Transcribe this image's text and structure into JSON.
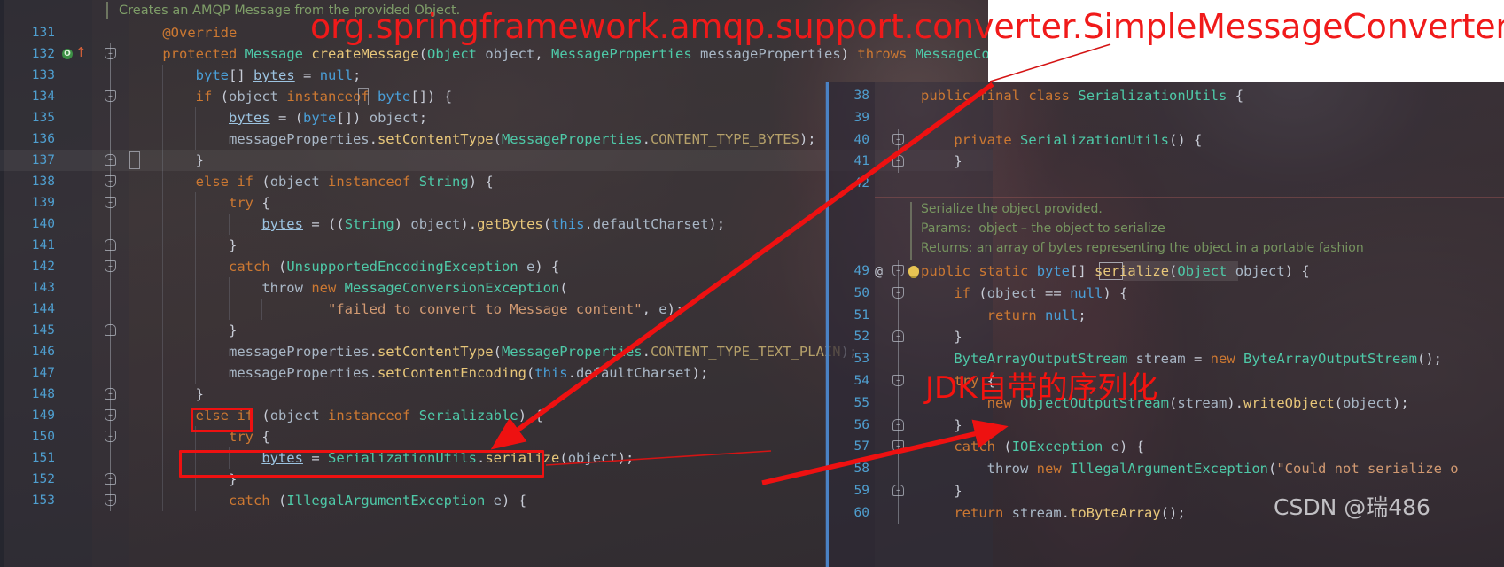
{
  "annotations": {
    "title_class": "org.springframework.amqp.support.converter.SimpleMessageConverter",
    "jdk_note": "JDK自带的序列化",
    "watermark": "CSDN @瑞486"
  },
  "left_editor": {
    "doc_comment": "Creates an AMQP Message from the provided Object.",
    "override_marker_icon": "overridden-method-icon",
    "lines": [
      {
        "num": "131",
        "text": "    @Override"
      },
      {
        "num": "132",
        "text": "    protected Message createMessage(Object object, MessageProperties messageProperties) throws MessageConversionException {"
      },
      {
        "num": "133",
        "text": "        byte[] bytes = null;"
      },
      {
        "num": "134",
        "text": "        if (object instanceof byte[]) {"
      },
      {
        "num": "135",
        "text": "            bytes = (byte[]) object;"
      },
      {
        "num": "136",
        "text": "            messageProperties.setContentType(MessageProperties.CONTENT_TYPE_BYTES);"
      },
      {
        "num": "137",
        "text": "        }"
      },
      {
        "num": "138",
        "text": "        else if (object instanceof String) {"
      },
      {
        "num": "139",
        "text": "            try {"
      },
      {
        "num": "140",
        "text": "                bytes = ((String) object).getBytes(this.defaultCharset);"
      },
      {
        "num": "141",
        "text": "            }"
      },
      {
        "num": "142",
        "text": "            catch (UnsupportedEncodingException e) {"
      },
      {
        "num": "143",
        "text": "                throw new MessageConversionException("
      },
      {
        "num": "144",
        "text": "                        \"failed to convert to Message content\", e);"
      },
      {
        "num": "145",
        "text": "            }"
      },
      {
        "num": "146",
        "text": "            messageProperties.setContentType(MessageProperties.CONTENT_TYPE_TEXT_PLAIN);"
      },
      {
        "num": "147",
        "text": "            messageProperties.setContentEncoding(this.defaultCharset);"
      },
      {
        "num": "148",
        "text": "        }"
      },
      {
        "num": "149",
        "text": "        else if (object instanceof Serializable) {"
      },
      {
        "num": "150",
        "text": "            try {"
      },
      {
        "num": "151",
        "text": "                bytes = SerializationUtils.serialize(object);"
      },
      {
        "num": "152",
        "text": "            }"
      },
      {
        "num": "153",
        "text": "            catch (IllegalArgumentException e) {"
      }
    ]
  },
  "right_popup": {
    "javadoc": [
      "Serialize the object provided.",
      "Params:  object – the object to serialize",
      "Returns: an array of bytes representing the object in a portable fashion"
    ],
    "lines": [
      {
        "num": "38",
        "text": "public final class SerializationUtils {"
      },
      {
        "num": "39",
        "text": ""
      },
      {
        "num": "40",
        "text": "    private SerializationUtils() {"
      },
      {
        "num": "41",
        "text": "    }"
      },
      {
        "num": "42",
        "text": ""
      },
      {
        "num": "49",
        "text": "public static byte[] serialize(Object object) {"
      },
      {
        "num": "50",
        "text": "    if (object == null) {"
      },
      {
        "num": "51",
        "text": "        return null;"
      },
      {
        "num": "52",
        "text": "    }"
      },
      {
        "num": "53",
        "text": "    ByteArrayOutputStream stream = new ByteArrayOutputStream();"
      },
      {
        "num": "54",
        "text": "    try {"
      },
      {
        "num": "55",
        "text": "        new ObjectOutputStream(stream).writeObject(object);"
      },
      {
        "num": "56",
        "text": "    }"
      },
      {
        "num": "57",
        "text": "    catch (IOException e) {"
      },
      {
        "num": "58",
        "text": "        throw new IllegalArgumentException(\"Could not serialize o"
      },
      {
        "num": "59",
        "text": "    }"
      },
      {
        "num": "60",
        "text": "    return stream.toByteArray();"
      }
    ],
    "annotation_marker": "@",
    "intention_icon": "lightbulb-icon"
  },
  "colors": {
    "annotation_red": "#ee1111",
    "line_number_blue": "#4f9fd0",
    "popup_border_blue": "#4a82c4",
    "comment_green": "#7f9e6a"
  }
}
